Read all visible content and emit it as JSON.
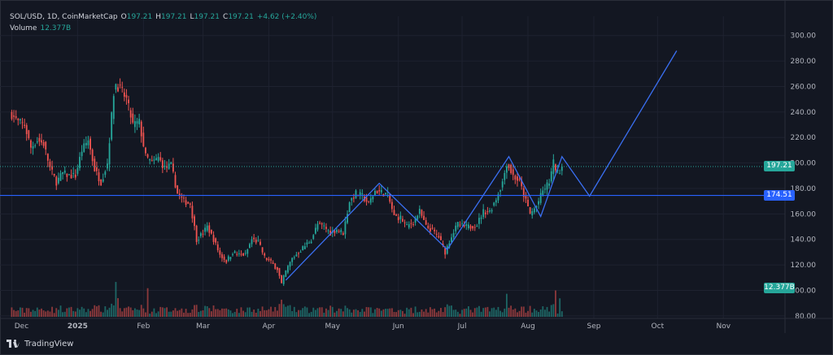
{
  "legend": {
    "symbol": "SOL/USD, 1D, CoinMarketCap",
    "o_label": "O",
    "o_value": "197.21",
    "h_label": "H",
    "h_value": "197.21",
    "l_label": "L",
    "l_value": "197.21",
    "c_label": "C",
    "c_value": "197.21",
    "change": "+4.62 (+2.40%)",
    "volume_label": "Volume",
    "volume_value": "12.377B"
  },
  "price_tag": "197.21",
  "level_tag": "174.51",
  "volume_tag": "12.377B",
  "branding": "TradingView",
  "colors": {
    "background": "#131722",
    "up": "#26a69a",
    "down": "#ef5350",
    "line": "#2962ff",
    "pattern": "#3a6ff2",
    "grid": "#1e2230",
    "axis_text": "#b2b5be"
  },
  "chart_data": {
    "type": "candlestick",
    "xlabel": "",
    "ylabel": "",
    "x_ticks": [
      "Dec",
      "2025",
      "Feb",
      "Mar",
      "Apr",
      "May",
      "Jun",
      "Jul",
      "Aug",
      "Sep",
      "Oct",
      "Nov"
    ],
    "y_ticks": [
      "80.00",
      "100.00",
      "120.00",
      "140.00",
      "160.00",
      "180.00",
      "200.00",
      "220.00",
      "240.00",
      "260.00",
      "280.00",
      "300.00"
    ],
    "ylim": [
      78,
      310
    ],
    "last_price": 197.21,
    "horizontal_level": 174.51,
    "close_path": [
      [
        "2024-12-01",
        238
      ],
      [
        "2024-12-04",
        232
      ],
      [
        "2024-12-07",
        230
      ],
      [
        "2024-12-10",
        212
      ],
      [
        "2024-12-13",
        218
      ],
      [
        "2024-12-16",
        215
      ],
      [
        "2024-12-19",
        196
      ],
      [
        "2024-12-22",
        185
      ],
      [
        "2024-12-25",
        192
      ],
      [
        "2024-12-28",
        190
      ],
      [
        "2024-12-31",
        190
      ],
      [
        "2025-01-03",
        210
      ],
      [
        "2025-01-06",
        218
      ],
      [
        "2025-01-09",
        195
      ],
      [
        "2025-01-12",
        185
      ],
      [
        "2025-01-15",
        200
      ],
      [
        "2025-01-18",
        255
      ],
      [
        "2025-01-19",
        262
      ],
      [
        "2025-01-21",
        258
      ],
      [
        "2025-01-24",
        250
      ],
      [
        "2025-01-27",
        230
      ],
      [
        "2025-01-30",
        232
      ],
      [
        "2025-02-02",
        205
      ],
      [
        "2025-02-05",
        200
      ],
      [
        "2025-02-08",
        204
      ],
      [
        "2025-02-11",
        196
      ],
      [
        "2025-02-14",
        198
      ],
      [
        "2025-02-17",
        176
      ],
      [
        "2025-02-20",
        170
      ],
      [
        "2025-02-23",
        168
      ],
      [
        "2025-02-26",
        140
      ],
      [
        "2025-03-01",
        145
      ],
      [
        "2025-03-03",
        150
      ],
      [
        "2025-03-06",
        140
      ],
      [
        "2025-03-09",
        128
      ],
      [
        "2025-03-12",
        123
      ],
      [
        "2025-03-15",
        130
      ],
      [
        "2025-03-18",
        128
      ],
      [
        "2025-03-21",
        128
      ],
      [
        "2025-03-24",
        140
      ],
      [
        "2025-03-27",
        138
      ],
      [
        "2025-03-30",
        126
      ],
      [
        "2025-04-02",
        122
      ],
      [
        "2025-04-05",
        117
      ],
      [
        "2025-04-07",
        105
      ],
      [
        "2025-04-09",
        115
      ],
      [
        "2025-04-12",
        125
      ],
      [
        "2025-04-15",
        130
      ],
      [
        "2025-04-18",
        135
      ],
      [
        "2025-04-21",
        140
      ],
      [
        "2025-04-24",
        152
      ],
      [
        "2025-04-27",
        150
      ],
      [
        "2025-04-30",
        145
      ],
      [
        "2025-05-03",
        148
      ],
      [
        "2025-05-06",
        145
      ],
      [
        "2025-05-09",
        170
      ],
      [
        "2025-05-12",
        176
      ],
      [
        "2025-05-15",
        174
      ],
      [
        "2025-05-18",
        168
      ],
      [
        "2025-05-21",
        178
      ],
      [
        "2025-05-24",
        177
      ],
      [
        "2025-05-27",
        175
      ],
      [
        "2025-05-30",
        158
      ],
      [
        "2025-06-02",
        157
      ],
      [
        "2025-06-05",
        150
      ],
      [
        "2025-06-08",
        154
      ],
      [
        "2025-06-11",
        162
      ],
      [
        "2025-06-14",
        150
      ],
      [
        "2025-06-17",
        147
      ],
      [
        "2025-06-20",
        142
      ],
      [
        "2025-06-23",
        130
      ],
      [
        "2025-06-26",
        143
      ],
      [
        "2025-06-29",
        152
      ],
      [
        "2025-07-02",
        150
      ],
      [
        "2025-07-05",
        150
      ],
      [
        "2025-07-08",
        152
      ],
      [
        "2025-07-11",
        162
      ],
      [
        "2025-07-14",
        162
      ],
      [
        "2025-07-17",
        172
      ],
      [
        "2025-07-20",
        185
      ],
      [
        "2025-07-22",
        200
      ],
      [
        "2025-07-25",
        190
      ],
      [
        "2025-07-28",
        185
      ],
      [
        "2025-07-31",
        170
      ],
      [
        "2025-08-02",
        160
      ],
      [
        "2025-08-05",
        166
      ],
      [
        "2025-08-08",
        178
      ],
      [
        "2025-08-11",
        185
      ],
      [
        "2025-08-13",
        200
      ],
      [
        "2025-08-15",
        192
      ],
      [
        "2025-08-17",
        197.21
      ]
    ],
    "volume_series_label": "Volume",
    "volume_last": "12.377B",
    "projection": [
      [
        "2025-04-09",
        108
      ],
      [
        "2025-05-23",
        184
      ],
      [
        "2025-06-24",
        132
      ],
      [
        "2025-07-23",
        205
      ],
      [
        "2025-08-07",
        158
      ],
      [
        "2025-08-17",
        205
      ],
      [
        "2025-08-30",
        174
      ],
      [
        "2025-10-10",
        288
      ]
    ]
  }
}
